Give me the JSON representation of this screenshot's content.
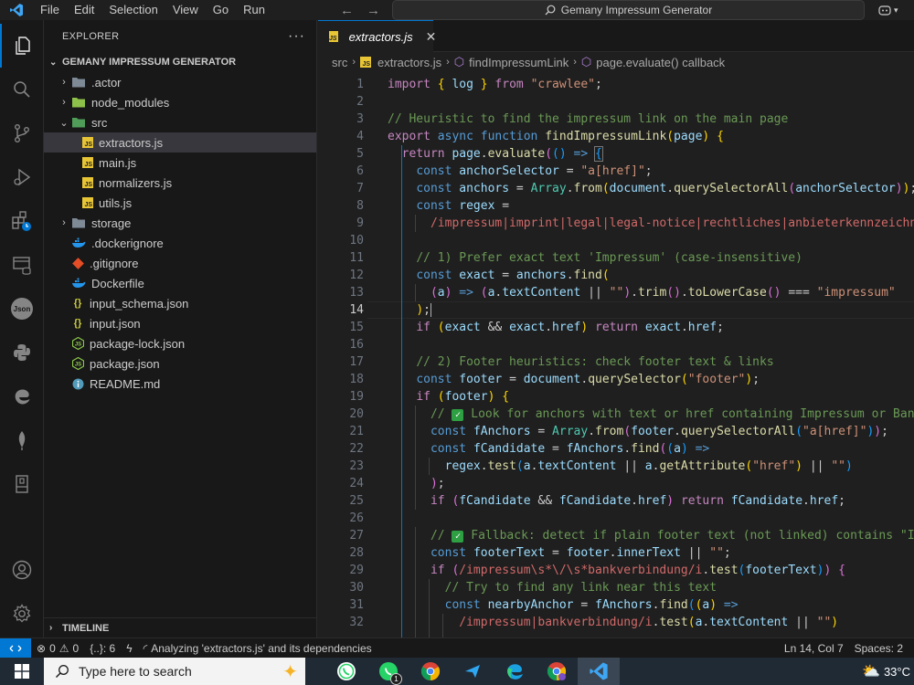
{
  "titlebar": {
    "menu": [
      "File",
      "Edit",
      "Selection",
      "View",
      "Go",
      "Run"
    ],
    "command_center": "Gemany Impressum Generator"
  },
  "sidebar": {
    "title": "EXPLORER",
    "project": "GEMANY IMPRESSUM GENERATOR",
    "tree": [
      {
        "label": ".actor",
        "kind": "folder",
        "expanded": false
      },
      {
        "label": "node_modules",
        "kind": "folder",
        "expanded": false
      },
      {
        "label": "src",
        "kind": "folder",
        "expanded": true
      },
      {
        "label": "extractors.js",
        "kind": "js",
        "selected": true
      },
      {
        "label": "main.js",
        "kind": "js"
      },
      {
        "label": "normalizers.js",
        "kind": "js"
      },
      {
        "label": "utils.js",
        "kind": "js"
      },
      {
        "label": "storage",
        "kind": "folder",
        "expanded": false
      },
      {
        "label": ".dockerignore",
        "kind": "docker"
      },
      {
        "label": ".gitignore",
        "kind": "git"
      },
      {
        "label": "Dockerfile",
        "kind": "docker"
      },
      {
        "label": "input_schema.json",
        "kind": "json"
      },
      {
        "label": "input.json",
        "kind": "json"
      },
      {
        "label": "package-lock.json",
        "kind": "npm"
      },
      {
        "label": "package.json",
        "kind": "npm"
      },
      {
        "label": "README.md",
        "kind": "info"
      }
    ],
    "timeline": "TIMELINE"
  },
  "editor": {
    "tab_label": "extractors.js",
    "breadcrumbs": [
      "src",
      "extractors.js",
      "findImpressumLink",
      "page.evaluate() callback"
    ],
    "current_line": 14
  },
  "statusbar": {
    "problems_errors": "0",
    "problems_warnings": "0",
    "ports": "{..}: 6",
    "analyzing": "Analyzing 'extractors.js' and its dependencies",
    "position": "Ln 14, Col 7",
    "spaces": "Spaces: 2"
  },
  "taskbar": {
    "search_placeholder": "Type here to search",
    "temperature": "33°C",
    "whatsapp_badge": "1"
  },
  "colors": {
    "accent": "#0078d4",
    "editor_bg": "#1f1f1f",
    "sidebar_bg": "#181818",
    "js_icon": "#e8c534"
  },
  "icons": [
    "vscode-logo-icon",
    "explorer-icon",
    "search-icon",
    "source-control-icon",
    "run-debug-icon",
    "extensions-icon",
    "remote-explorer-icon",
    "json-icon",
    "python-icon",
    "edge-icon",
    "mongodb-leaf-icon",
    "book-icon",
    "account-icon",
    "settings-gear-icon",
    "windows-start-icon",
    "whatsapp-icon",
    "chrome-icon",
    "edge-icon",
    "vscode-icon",
    "weather-icon"
  ]
}
